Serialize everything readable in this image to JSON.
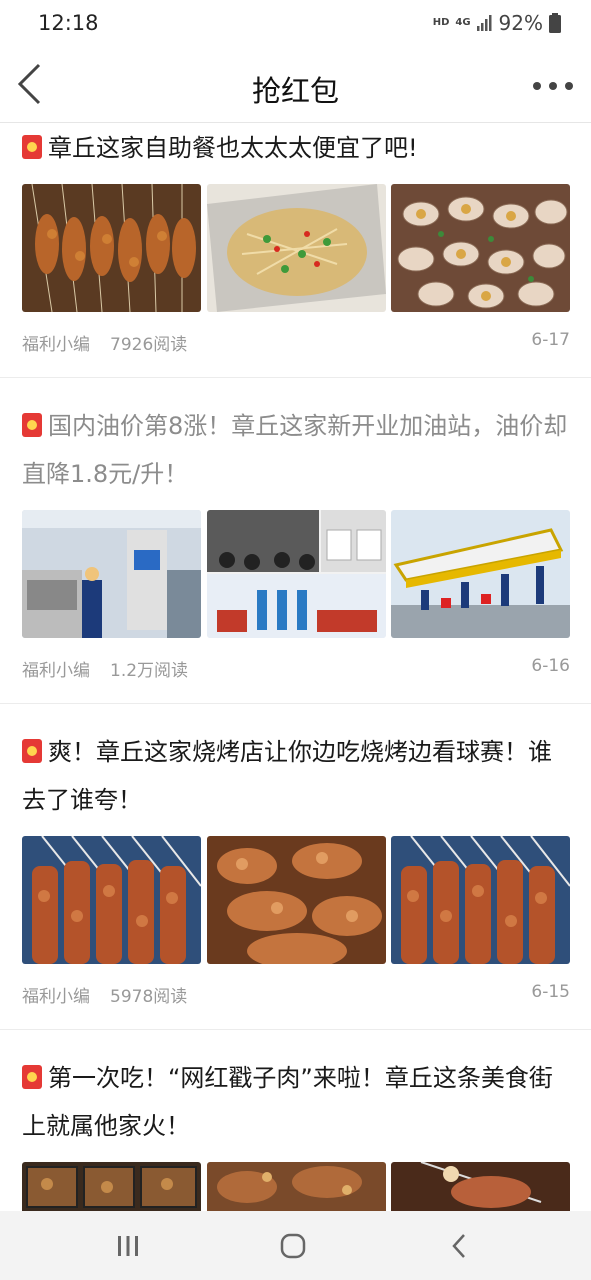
{
  "status_bar": {
    "time": "12:18",
    "hd": "HD",
    "net": "4G",
    "battery": "92%"
  },
  "nav": {
    "title": "抢红包"
  },
  "articles": [
    {
      "title": "章丘这家自助餐也太太太便宜了吧!",
      "author": "福利小编",
      "reads": "7926阅读",
      "date": "6-17",
      "read": false
    },
    {
      "title": "国内油价第8涨！章丘这家新开业加油站，油价却直降1.8元/升！",
      "author": "福利小编",
      "reads": "1.2万阅读",
      "date": "6-16",
      "read": true
    },
    {
      "title": "爽！章丘这家烧烤店让你边吃烧烤边看球赛！谁去了谁夸！",
      "author": "福利小编",
      "reads": "5978阅读",
      "date": "6-15",
      "read": false
    },
    {
      "title": "第一次吃！“网红戳子肉”来啦！章丘这条美食街上就属他家火！",
      "author": "",
      "reads": "",
      "date": "",
      "read": false
    }
  ],
  "icons": [
    "back-icon",
    "more-icon",
    "red-packet-icon",
    "recent-apps-icon",
    "home-icon",
    "nav-back-icon"
  ],
  "colors": {
    "red_packet": "#e53935",
    "meta_text": "#999999"
  }
}
